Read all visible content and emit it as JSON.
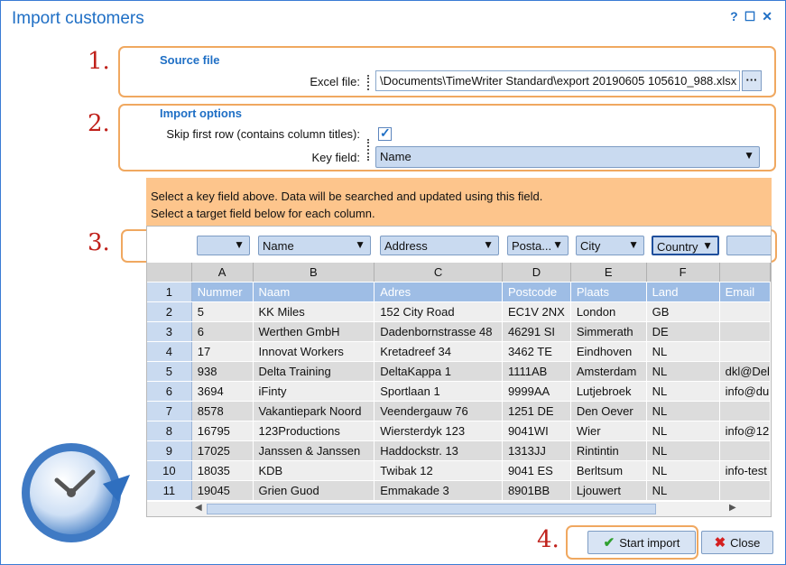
{
  "window": {
    "title": "Import customers",
    "help": "?",
    "maximize": "☐",
    "close": "✕"
  },
  "steps": [
    "1.",
    "2.",
    "3.",
    "4."
  ],
  "source": {
    "heading": "Source file",
    "excel_label": "Excel file:",
    "excel_value": "\\Documents\\TimeWriter Standard\\export 20190605 105610_988.xlsx",
    "browse": "···"
  },
  "options": {
    "heading": "Import options",
    "skip_label": "Skip first row (contains column titles):",
    "skip_checked": true,
    "check_glyph": "✓",
    "key_label": "Key field:",
    "key_value": "Name"
  },
  "info": {
    "line1": "Select a key field above. Data will be searched and updated using this field.",
    "line2": "Select a target field below for each column."
  },
  "mapping": [
    "",
    "Name",
    "Address",
    "Posta...",
    "City",
    "Country",
    ""
  ],
  "grid": {
    "columns": [
      "",
      "A",
      "B",
      "C",
      "D",
      "E",
      "F",
      ""
    ],
    "rows": [
      [
        "1",
        "Nummer",
        "Naam",
        "Adres",
        "Postcode",
        "Plaats",
        "Land",
        "Email"
      ],
      [
        "2",
        "5",
        "KK Miles",
        "152 City Road",
        "EC1V 2NX",
        "London",
        "GB",
        ""
      ],
      [
        "3",
        "6",
        "Werthen GmbH",
        "Dadenbornstrasse 48",
        "46291 SI",
        "Simmerath",
        "DE",
        ""
      ],
      [
        "4",
        "17",
        "Innovat Workers",
        "Kretadreef 34",
        "3462 TE",
        "Eindhoven",
        "NL",
        ""
      ],
      [
        "5",
        "938",
        "Delta Training",
        "DeltaKappa 1",
        "1111AB",
        "Amsterdam",
        "NL",
        "dkl@Del"
      ],
      [
        "6",
        "3694",
        "iFinty",
        "Sportlaan 1",
        "9999AA",
        "Lutjebroek",
        "NL",
        "info@du"
      ],
      [
        "7",
        "8578",
        "Vakantiepark Noord",
        "Veendergauw 76",
        "1251 DE",
        "Den Oever",
        "NL",
        ""
      ],
      [
        "8",
        "16795",
        "123Productions",
        "Wiersterdyk 123",
        "9041WI",
        "Wier",
        "NL",
        "info@12"
      ],
      [
        "9",
        "17025",
        "Janssen & Janssen",
        "Haddockstr. 13",
        "1313JJ",
        "Rintintin",
        "NL",
        ""
      ],
      [
        "10",
        "18035",
        "KDB",
        "Twibak 12",
        "9041 ES",
        "Berltsum",
        "NL",
        "info-test"
      ],
      [
        "11",
        "19045",
        "Grien Guod",
        "Emmakade 3",
        "8901BB",
        "Ljouwert",
        "NL",
        ""
      ]
    ]
  },
  "buttons": {
    "start": "Start import",
    "close": "Close"
  },
  "colors": {
    "accent": "#1f6fc5",
    "highlight": "#f0a860",
    "step": "#c0211b",
    "info_bg": "#fdc58c"
  }
}
